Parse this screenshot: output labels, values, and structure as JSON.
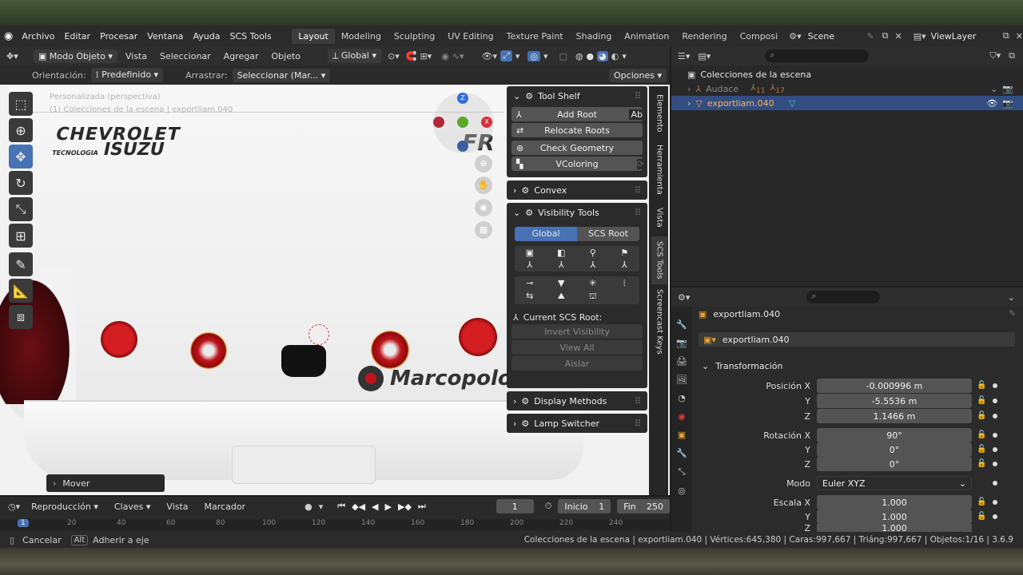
{
  "menu": {
    "blender_logo": "blender-icon",
    "items": [
      "Archivo",
      "Editar",
      "Procesar",
      "Ventana",
      "Ayuda",
      "SCS Tools"
    ]
  },
  "workspaces": {
    "tabs": [
      "Layout",
      "Modeling",
      "Sculpting",
      "UV Editing",
      "Texture Paint",
      "Shading",
      "Animation",
      "Rendering",
      "Composi"
    ],
    "active": "Layout",
    "scene": "Scene",
    "view_layer": "ViewLayer"
  },
  "viewport_header": {
    "mode": "Modo Objeto",
    "menus": [
      "Vista",
      "Seleccionar",
      "Agregar",
      "Objeto"
    ],
    "transform_orientation": "Global"
  },
  "tool_header": {
    "orientation_label": "Orientación:",
    "orientation_value": "Predefinido",
    "drag_label": "Arrastrar:",
    "drag_value": "Seleccionar (Mar...",
    "options": "Opciones"
  },
  "viewport": {
    "overlay_line1": "Personalizada (perspectiva)",
    "overlay_line2": "(1) Colecciones de la escena | exportliam.040",
    "brand_chevrolet": "CHEVROLET",
    "brand_tecnologia": "TECNOLOGIA",
    "brand_isuzu": "ISUZU",
    "brand_marcopolo": "Marcopolo",
    "brand_partial": "FR",
    "operator_panel": "Mover"
  },
  "npanel": {
    "tool_shelf": "Tool Shelf",
    "add_root": "Add Root",
    "relocate_roots": "Relocate Roots",
    "check_geometry": "Check Geometry",
    "vcoloring": "VColoring",
    "convex": "Convex",
    "visibility_tools": "Visibility Tools",
    "global": "Global",
    "scs_root": "SCS Root",
    "current_root": "Current SCS Root:",
    "invert_visibility": "Invert Visibility",
    "view_all": "View All",
    "isolate": "Aislar",
    "display_methods": "Display Methods",
    "lamp_switcher": "Lamp Switcher",
    "side_tabs": [
      "Elemento",
      "Herramienta",
      "Vista",
      "SCS Tools",
      "Screencast Keys"
    ]
  },
  "outliner": {
    "root": "Colecciones de la escena",
    "items": [
      {
        "name": "Audace",
        "badges": [
          "11",
          "17"
        ],
        "selected": false
      },
      {
        "name": "exportliam.040",
        "selected": true
      }
    ]
  },
  "properties": {
    "object_name": "exportliam.040",
    "object_field": "exportliam.040",
    "section": "Transformación",
    "rows": [
      {
        "label": "Posición X",
        "value": "-0.000996 m"
      },
      {
        "label": "Y",
        "value": "-5.5536 m"
      },
      {
        "label": "Z",
        "value": "1.1466 m"
      },
      {
        "label": "Rotación X",
        "value": "90°"
      },
      {
        "label": "Y",
        "value": "0°"
      },
      {
        "label": "Z",
        "value": "0°"
      },
      {
        "label": "Modo",
        "value": "Euler XYZ"
      },
      {
        "label": "Escala X",
        "value": "1.000"
      },
      {
        "label": "Y",
        "value": "1.000"
      },
      {
        "label": "Z",
        "value": "1.000"
      }
    ]
  },
  "timeline": {
    "playback": "Reproducción",
    "keys": "Claves",
    "view": "Vista",
    "marker": "Marcador",
    "current_frame": "1",
    "start_label": "Inicio",
    "start": "1",
    "end_label": "Fin",
    "end": "250",
    "ruler": [
      "1",
      "20",
      "40",
      "60",
      "80",
      "100",
      "120",
      "140",
      "160",
      "180",
      "200",
      "220",
      "240"
    ]
  },
  "statusbar": {
    "cancel": "Cancelar",
    "alt_key": "Alt",
    "snap": "Adherir a eje",
    "stats": "Colecciones de la escena | exportliam.040 | Vértices:645,380 | Caras:997,667 | Triáng:997,667 | Objetos:1/16 | 3.6.9"
  },
  "colors": {
    "accent": "#4772b3",
    "selected_row": "#334d80",
    "light_red": "#c0141a",
    "orange_outline": "#e08a20"
  }
}
